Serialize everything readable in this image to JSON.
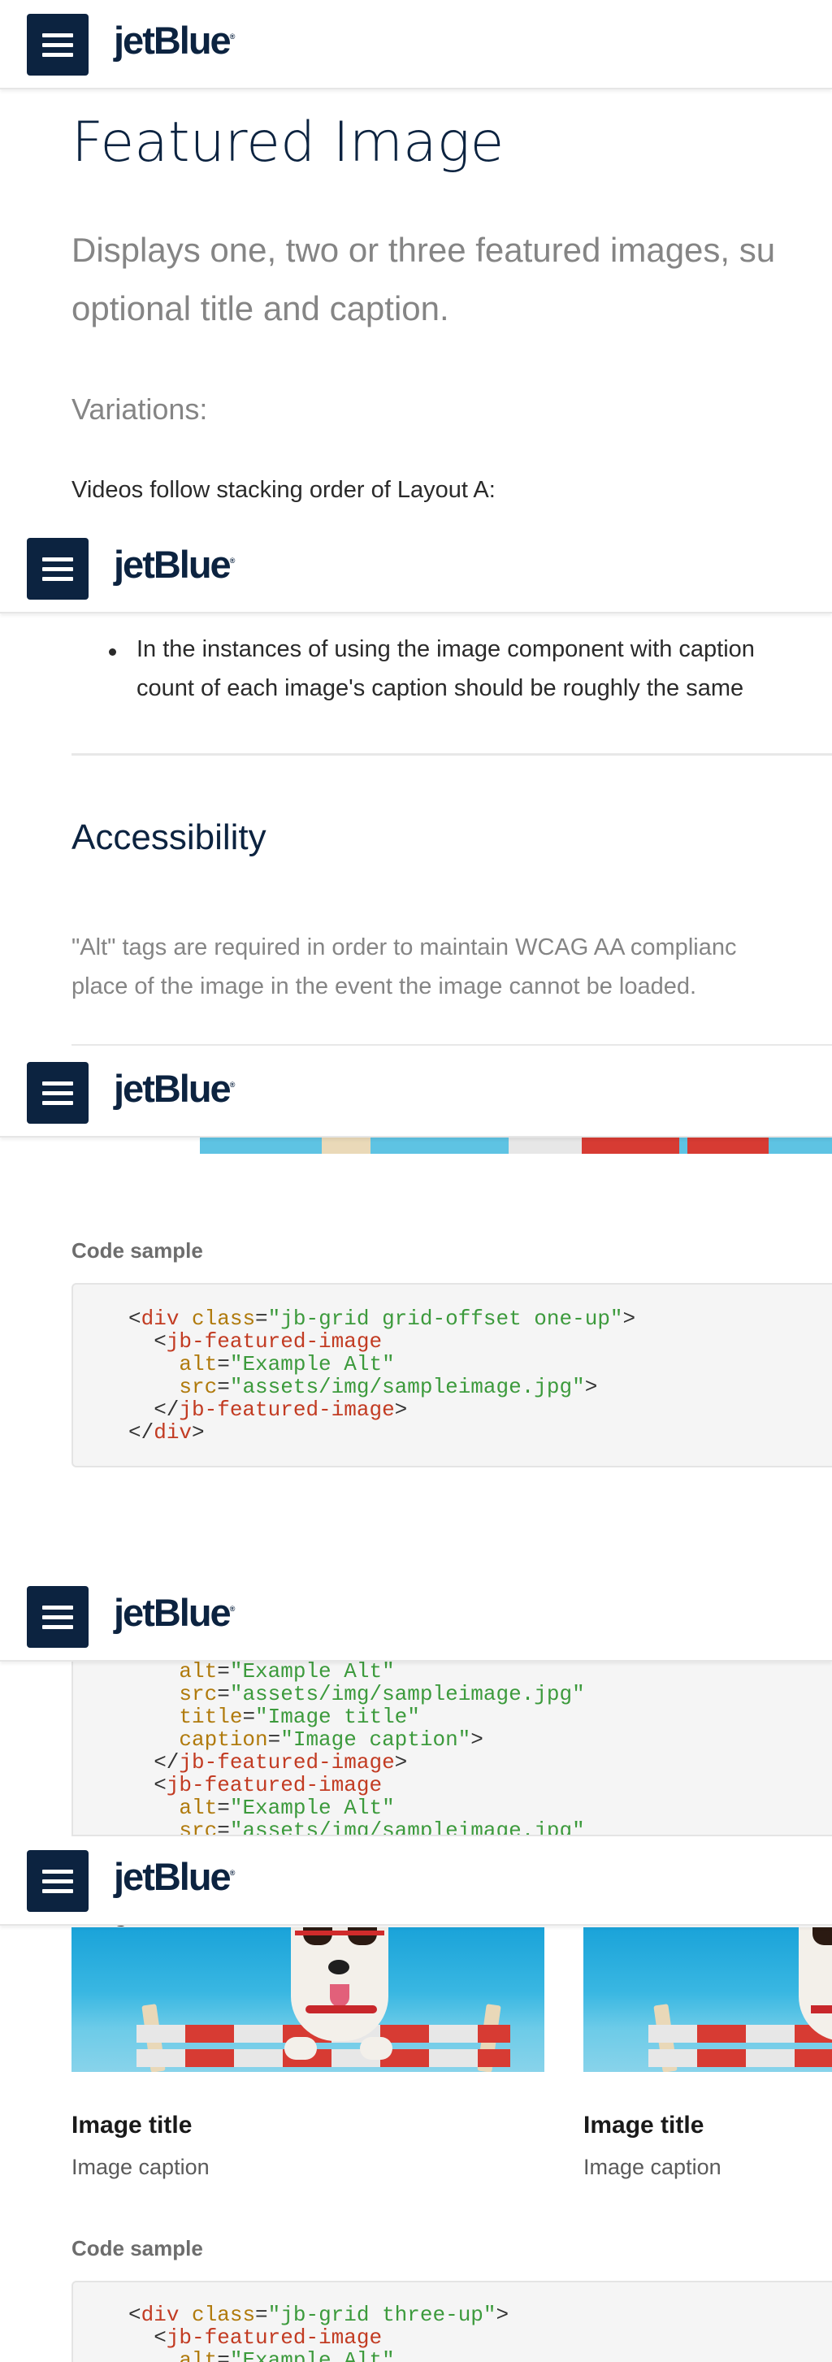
{
  "brand": {
    "logo_text": "jetBlue",
    "logo_mark": "®"
  },
  "header": {
    "menu_icon": "hamburger-menu-icon"
  },
  "intro": {
    "title": "Featured Image",
    "lead_line1": "Displays one, two or three featured images, su",
    "lead_line2": "optional title and caption.",
    "variations_label": "Variations:",
    "videos_note": "Videos follow stacking order of Layout A:"
  },
  "guidelines": {
    "bullet_line1": "In the instances of using the image component with caption",
    "bullet_line2": "count of each image's caption should be roughly the same"
  },
  "accessibility": {
    "heading": "Accessibility",
    "line1": "\"Alt\" tags are required in order to maintain WCAG AA complianc",
    "line2": "place of the image in the event the image cannot be loaded."
  },
  "one_up": {
    "code_label": "Code sample",
    "code_lines": [
      [
        [
          "pun",
          "<"
        ],
        [
          "tag",
          "div"
        ],
        [
          "pun",
          " "
        ],
        [
          "attr",
          "class"
        ],
        [
          "pun",
          "="
        ],
        [
          "str",
          "\"jb-grid grid-offset one-up\""
        ],
        [
          "pun",
          ">"
        ]
      ],
      [
        [
          "pun",
          "  <"
        ],
        [
          "tag",
          "jb-featured-image"
        ]
      ],
      [
        [
          "pun",
          "    "
        ],
        [
          "attr",
          "alt"
        ],
        [
          "pun",
          "="
        ],
        [
          "str",
          "\"Example Alt\""
        ]
      ],
      [
        [
          "pun",
          "    "
        ],
        [
          "attr",
          "src"
        ],
        [
          "pun",
          "="
        ],
        [
          "str",
          "\"assets/img/sampleimage.jpg\""
        ],
        [
          "pun",
          ">"
        ]
      ],
      [
        [
          "pun",
          "  </"
        ],
        [
          "tag",
          "jb-featured-image"
        ],
        [
          "pun",
          ">"
        ]
      ],
      [
        [
          "pun",
          "</"
        ],
        [
          "tag",
          "div"
        ],
        [
          "pun",
          ">"
        ]
      ]
    ]
  },
  "two_up": {
    "code_lines": [
      [
        [
          "pun",
          "    "
        ],
        [
          "attr",
          "alt"
        ],
        [
          "pun",
          "="
        ],
        [
          "str",
          "\"Example Alt\""
        ]
      ],
      [
        [
          "pun",
          "    "
        ],
        [
          "attr",
          "src"
        ],
        [
          "pun",
          "="
        ],
        [
          "str",
          "\"assets/img/sampleimage.jpg\""
        ]
      ],
      [
        [
          "pun",
          "    "
        ],
        [
          "attr",
          "title"
        ],
        [
          "pun",
          "="
        ],
        [
          "str",
          "\"Image title\""
        ]
      ],
      [
        [
          "pun",
          "    "
        ],
        [
          "attr",
          "caption"
        ],
        [
          "pun",
          "="
        ],
        [
          "str",
          "\"Image caption\""
        ],
        [
          "pun",
          ">"
        ]
      ],
      [
        [
          "pun",
          "  </"
        ],
        [
          "tag",
          "jb-featured-image"
        ],
        [
          "pun",
          ">"
        ]
      ],
      [
        [
          "pun",
          "  <"
        ],
        [
          "tag",
          "jb-featured-image"
        ]
      ],
      [
        [
          "pun",
          "    "
        ],
        [
          "attr",
          "alt"
        ],
        [
          "pun",
          "="
        ],
        [
          "str",
          "\"Example Alt\""
        ]
      ],
      [
        [
          "pun",
          "    "
        ],
        [
          "attr",
          "src"
        ],
        [
          "pun",
          "="
        ],
        [
          "str",
          "\"assets/img/sampleimage.jpg\""
        ]
      ]
    ]
  },
  "three_up": {
    "cards": [
      {
        "title": "Image title",
        "caption": "Image caption"
      },
      {
        "title": "Image title",
        "caption": "Image caption"
      }
    ],
    "code_label": "Code sample",
    "code_lines": [
      [
        [
          "pun",
          "<"
        ],
        [
          "tag",
          "div"
        ],
        [
          "pun",
          " "
        ],
        [
          "attr",
          "class"
        ],
        [
          "pun",
          "="
        ],
        [
          "str",
          "\"jb-grid three-up\""
        ],
        [
          "pun",
          ">"
        ]
      ],
      [
        [
          "pun",
          "  <"
        ],
        [
          "tag",
          "jb-featured-image"
        ]
      ],
      [
        [
          "pun",
          "    "
        ],
        [
          "attr",
          "alt"
        ],
        [
          "pun",
          "="
        ],
        [
          "str",
          "\"Example Alt\""
        ]
      ]
    ]
  },
  "colors": {
    "navy": "#0c2340",
    "gray_text": "#858585",
    "code_bg": "#f5f5f5",
    "tag": "#c23b22",
    "attr": "#b07a0c",
    "string": "#3c9a3c"
  }
}
